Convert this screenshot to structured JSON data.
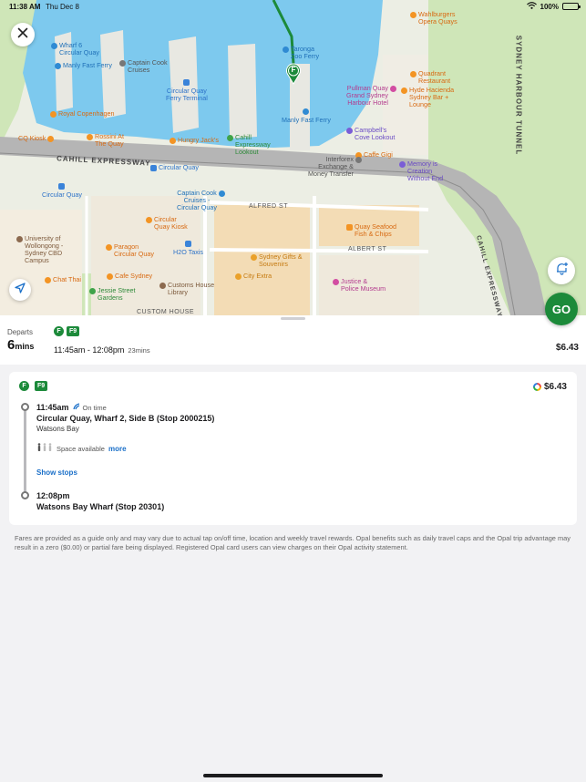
{
  "status_bar": {
    "time": "11:38 AM",
    "date": "Thu Dec 8",
    "battery": "100%"
  },
  "map": {
    "roads": {
      "expressway": "CAHILL EXPRESSWAY",
      "tunnel": "SYDNEY HARBOUR TUNNEL",
      "expressway_2": "CAHILL EXPRESSWAY",
      "alfred": "ALFRED ST",
      "albert": "ALBERT ST",
      "custom": "CUSTOM HOUSE"
    },
    "pois": {
      "wharf6": "Wharf 6\nCircular Quay",
      "manly_fast_ferry_1": "Manly Fast Ferry",
      "captain_cook_1": "Captain Cook\nCruises",
      "taronga": "Taronga\nZoo Ferry",
      "wahlburgers": "Wahlburgers\nOpera Quays",
      "ferry_terminal": "Circular Quay\nFerry Terminal",
      "quadrant": "Quadrant\nRestaurant",
      "pullman": "Pullman Quay\nGrand Sydney\nHarbour Hotel",
      "hyde": "Hyde Hacienda\nSydney Bar +\nLounge",
      "manly_fast_ferry_2": "Manly Fast Ferry",
      "royal_cph": "Royal Copenhagen",
      "campbells": "Campbell's\nCove Lookout",
      "rossini": "Rossini At\nThe Quay",
      "cq_kiosk": "CQ Kiosk",
      "hungry_jacks": "Hungry Jack's",
      "cahill_lookout": "Cahill\nExpressway\nLookout",
      "caffe_gigi": "Caffe Gigi",
      "interforex": "Interforex\nExchange &\nMoney Transfer",
      "memory": "Memory is\nCreation\nWithout End",
      "circular_quay_stn": "Circular Quay",
      "circular_quay_stn_2": "Circular Quay",
      "captain_cook_2": "Captain Cook\nCruises -\nCircular Quay",
      "cq_kiosk_2": "Circular\nQuay Kiosk",
      "quay_seafood": "Quay Seafood\nFish & Chips",
      "uow": "University of\nWollongong -\nSydney CBD\nCampus",
      "paragon": "Paragon\nCircular Quay",
      "h2o": "H2O Taxis",
      "sydney_gifts": "Sydney Gifts &\nSouvenirs",
      "city_extra": "City Extra",
      "chat_thai": "Chat Thai",
      "cafe_sydney": "Cafe Sydney",
      "justice": "Justice &\nPolice Museum",
      "jessie": "Jessie Street\nGardens",
      "customs_lib": "Customs House\nLibrary"
    },
    "ferry_marker_letter": "F",
    "go_label": "GO"
  },
  "summary": {
    "departs_label": "Departs",
    "departs_value": "6",
    "departs_unit": "mins",
    "mode_letter": "F",
    "route": "F9",
    "time_range": "11:45am - 12:08pm",
    "duration": "23mins",
    "fare": "$6.43"
  },
  "trip": {
    "mode_letter": "F",
    "route": "F9",
    "fare": "$6.43",
    "depart_time": "11:45am",
    "status": "On time",
    "origin": "Circular Quay, Wharf 2, Side B (Stop 2000215)",
    "destination": "Watsons Bay",
    "occupancy": "Space available",
    "more": "more",
    "show_stops": "Show stops",
    "arrive_time": "12:08pm",
    "arrive_stop": "Watsons Bay Wharf (Stop 20301)"
  },
  "disclaimer": "Fares are provided as a guide only and may vary due to actual tap on/off time, location and weekly travel rewards. Opal benefits such as daily travel caps and the Opal trip advantage may result in a zero ($0.00) or partial fare being displayed. Registered Opal card users can view charges on their Opal activity statement.",
  "colors": {
    "brand_green": "#1c8a3a",
    "link_blue": "#1a6fc8",
    "water": "#7dc9ee"
  }
}
